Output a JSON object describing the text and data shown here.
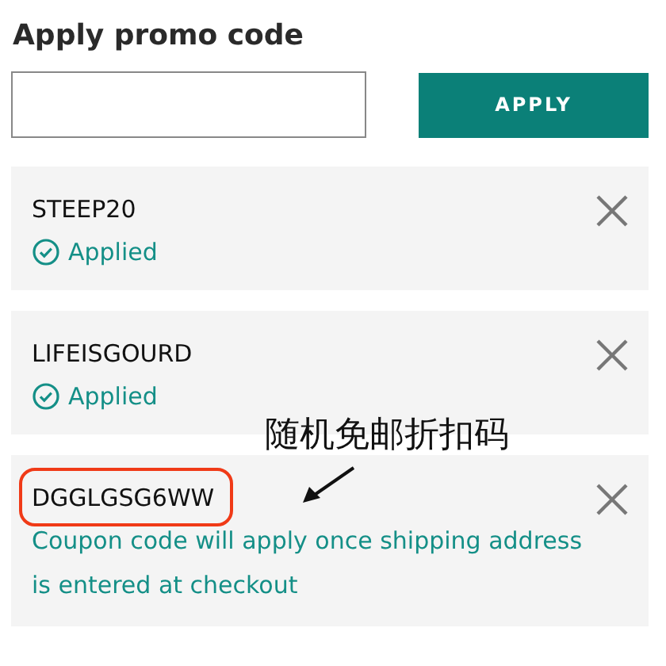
{
  "title": "Apply promo code",
  "apply_button": {
    "label": "APPLY"
  },
  "codes": [
    {
      "code": "STEEP20",
      "kind": "applied",
      "status": "Applied",
      "highlighted": false
    },
    {
      "code": "LIFEISGOURD",
      "kind": "applied",
      "status": "Applied",
      "highlighted": false
    },
    {
      "code": "DGGLGSG6WW",
      "kind": "pending",
      "status": "Coupon code will apply once shipping address is entered at checkout",
      "highlighted": true
    }
  ],
  "annotation": {
    "label": "随机免邮折扣码"
  }
}
